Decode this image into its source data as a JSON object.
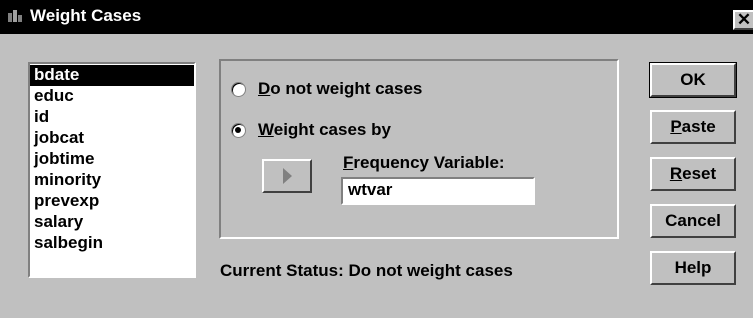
{
  "window": {
    "title": "Weight Cases",
    "close_glyph": "✕"
  },
  "variables": [
    "bdate",
    "educ",
    "id",
    "jobcat",
    "jobtime",
    "minority",
    "prevexp",
    "salary",
    "salbegin"
  ],
  "selected_variable": "bdate",
  "options": {
    "no_weight": {
      "mnemonic": "D",
      "rest": "o not weight cases",
      "checked": false
    },
    "weight_by": {
      "mnemonic": "W",
      "rest": "eight cases by",
      "checked": true
    }
  },
  "frequency": {
    "label_mnemonic": "F",
    "label_rest": "requency Variable:",
    "value": "wtvar"
  },
  "status": "Current Status: Do not weight cases",
  "buttons": {
    "ok": "OK",
    "paste_mnemonic": "P",
    "paste_rest": "aste",
    "reset_mnemonic": "R",
    "reset_rest": "eset",
    "cancel": "Cancel",
    "help": "Help"
  }
}
